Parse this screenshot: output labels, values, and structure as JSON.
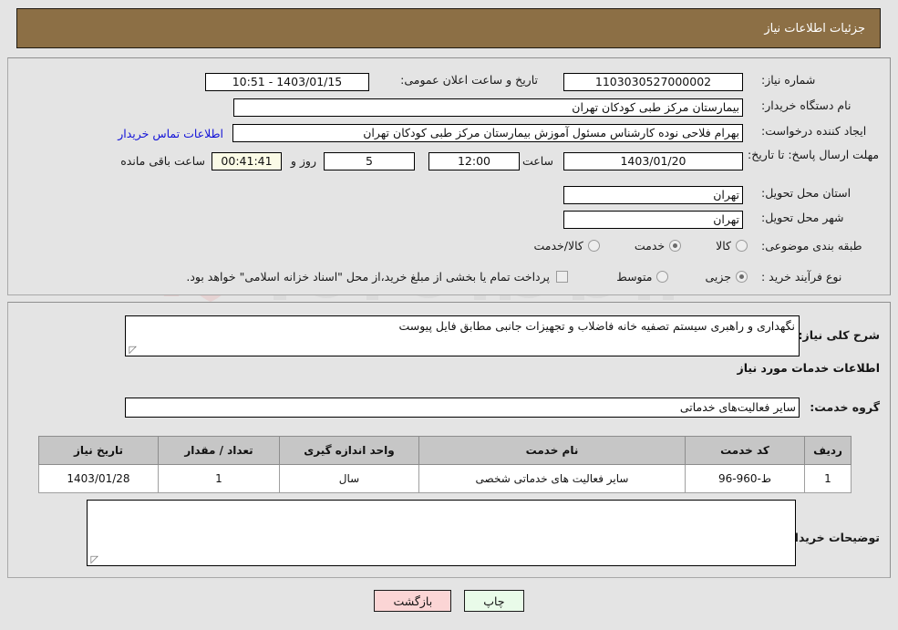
{
  "header": {
    "title": "جزئیات اطلاعات نیاز",
    "bar_color": "#8c6f45"
  },
  "form": {
    "need_number_label": "شماره نیاز:",
    "need_number_value": "1103030527000002",
    "buyer_org_label": "نام دستگاه خریدار:",
    "buyer_org_value": "بیمارستان مرکز طبی کودکان تهران",
    "creator_label": "ایجاد کننده درخواست:",
    "creator_value": "بهرام فلاحی نوده کارشناس مسئول آموزش بیمارستان مرکز طبی کودکان تهران",
    "contact_link": "اطلاعات تماس خریدار",
    "deadline_label": "مهلت ارسال پاسخ: تا تاریخ:",
    "deadline_date": "1403/01/20",
    "hour_label": "ساعت",
    "hour_value": "12:00",
    "days_value": "5",
    "days_label": "روز و",
    "timer_value": "00:41:41",
    "timer_label": "ساعت باقی مانده",
    "announce_label": "تاریخ و ساعت اعلان عمومی:",
    "announce_value": "1403/01/15 - 10:51",
    "province_label": "استان محل تحویل:",
    "province_value": "تهران",
    "city_label": "شهر محل تحویل:",
    "city_value": "تهران",
    "category_label": "طبقه بندی موضوعی:",
    "category_options": [
      {
        "label": "کالا",
        "selected": false
      },
      {
        "label": "خدمت",
        "selected": true
      },
      {
        "label": "کالا/خدمت",
        "selected": false
      }
    ],
    "process_label": "نوع فرآیند خرید :",
    "process_options": [
      {
        "label": "جزیی",
        "selected": true
      },
      {
        "label": "متوسط",
        "selected": false
      }
    ],
    "treasury_checkbox_label": "پرداخت تمام یا بخشی از مبلغ خرید،از محل \"اسناد خزانه اسلامی\" خواهد بود.",
    "treasury_checked": false
  },
  "description": {
    "label": "شرح کلی نیاز:",
    "value": "نگهداری و راهبری سیستم تصفیه خانه فاضلاب و تجهیزات جانبی مطابق فایل پیوست"
  },
  "services_section": {
    "heading": "اطلاعات خدمات مورد نیاز",
    "group_label": "گروه خدمت:",
    "group_value": "سایر فعالیت‌های خدماتی"
  },
  "table": {
    "columns": [
      "ردیف",
      "کد خدمت",
      "نام خدمت",
      "واحد اندازه گیری",
      "تعداد / مقدار",
      "تاریخ نیاز"
    ],
    "rows": [
      {
        "row_no": "1",
        "service_code": "ط-960-96",
        "service_name": "سایر فعالیت های خدماتی شخصی",
        "unit": "سال",
        "quantity": "1",
        "need_date": "1403/01/28"
      }
    ]
  },
  "buyer_notes": {
    "label": "توضیحات خریدار:",
    "value": ""
  },
  "footer": {
    "back_label": "بازگشت",
    "print_label": "چاپ",
    "back_color": "#fbd5d5",
    "print_color": "#e9fbe9"
  }
}
